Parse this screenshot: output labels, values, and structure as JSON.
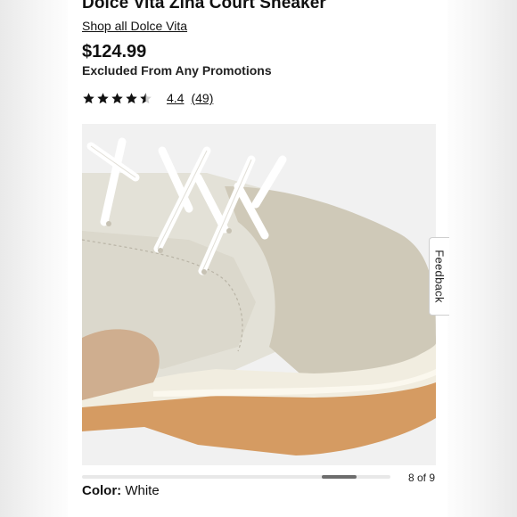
{
  "product": {
    "title": "Dolce Vita Zina Court Sneaker",
    "shop_link": "Shop all Dolce Vita",
    "price": "$124.99",
    "promotion": "Excluded From Any Promotions"
  },
  "rating": {
    "stars": 4.4,
    "value_text": "4.4",
    "count_text": "(49)"
  },
  "gallery": {
    "counter": "8 of 9",
    "current": 8,
    "total": 9,
    "image_name": "sneaker-closeup-image"
  },
  "feedback": {
    "label": "Feedback"
  },
  "color": {
    "label": "Color:",
    "value": "White"
  },
  "colors": {
    "star": "#111111",
    "progress_fill": "#6d6d6d",
    "progress_track": "#e8e8e8"
  }
}
